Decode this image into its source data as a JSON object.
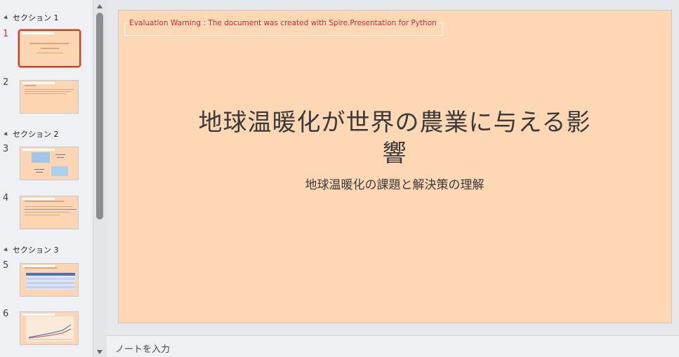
{
  "sections": [
    {
      "label": "セクション 1"
    },
    {
      "label": "セクション 2"
    },
    {
      "label": "セクション 3"
    }
  ],
  "slides": [
    {
      "number": "1",
      "active": true
    },
    {
      "number": "2"
    },
    {
      "number": "3"
    },
    {
      "number": "4"
    },
    {
      "number": "5"
    },
    {
      "number": "6"
    }
  ],
  "slide": {
    "warning": "Evaluation Warning : The document was created with Spire.Presentation for Python",
    "title": "地球温暖化が世界の農業に与える影響",
    "subtitle": "地球温暖化の課題と解決策の理解",
    "background_color": "#fed7b5"
  },
  "notes": {
    "placeholder": "ノートを入力"
  },
  "colors": {
    "accent": "#b5492f",
    "warning": "#e02020"
  }
}
